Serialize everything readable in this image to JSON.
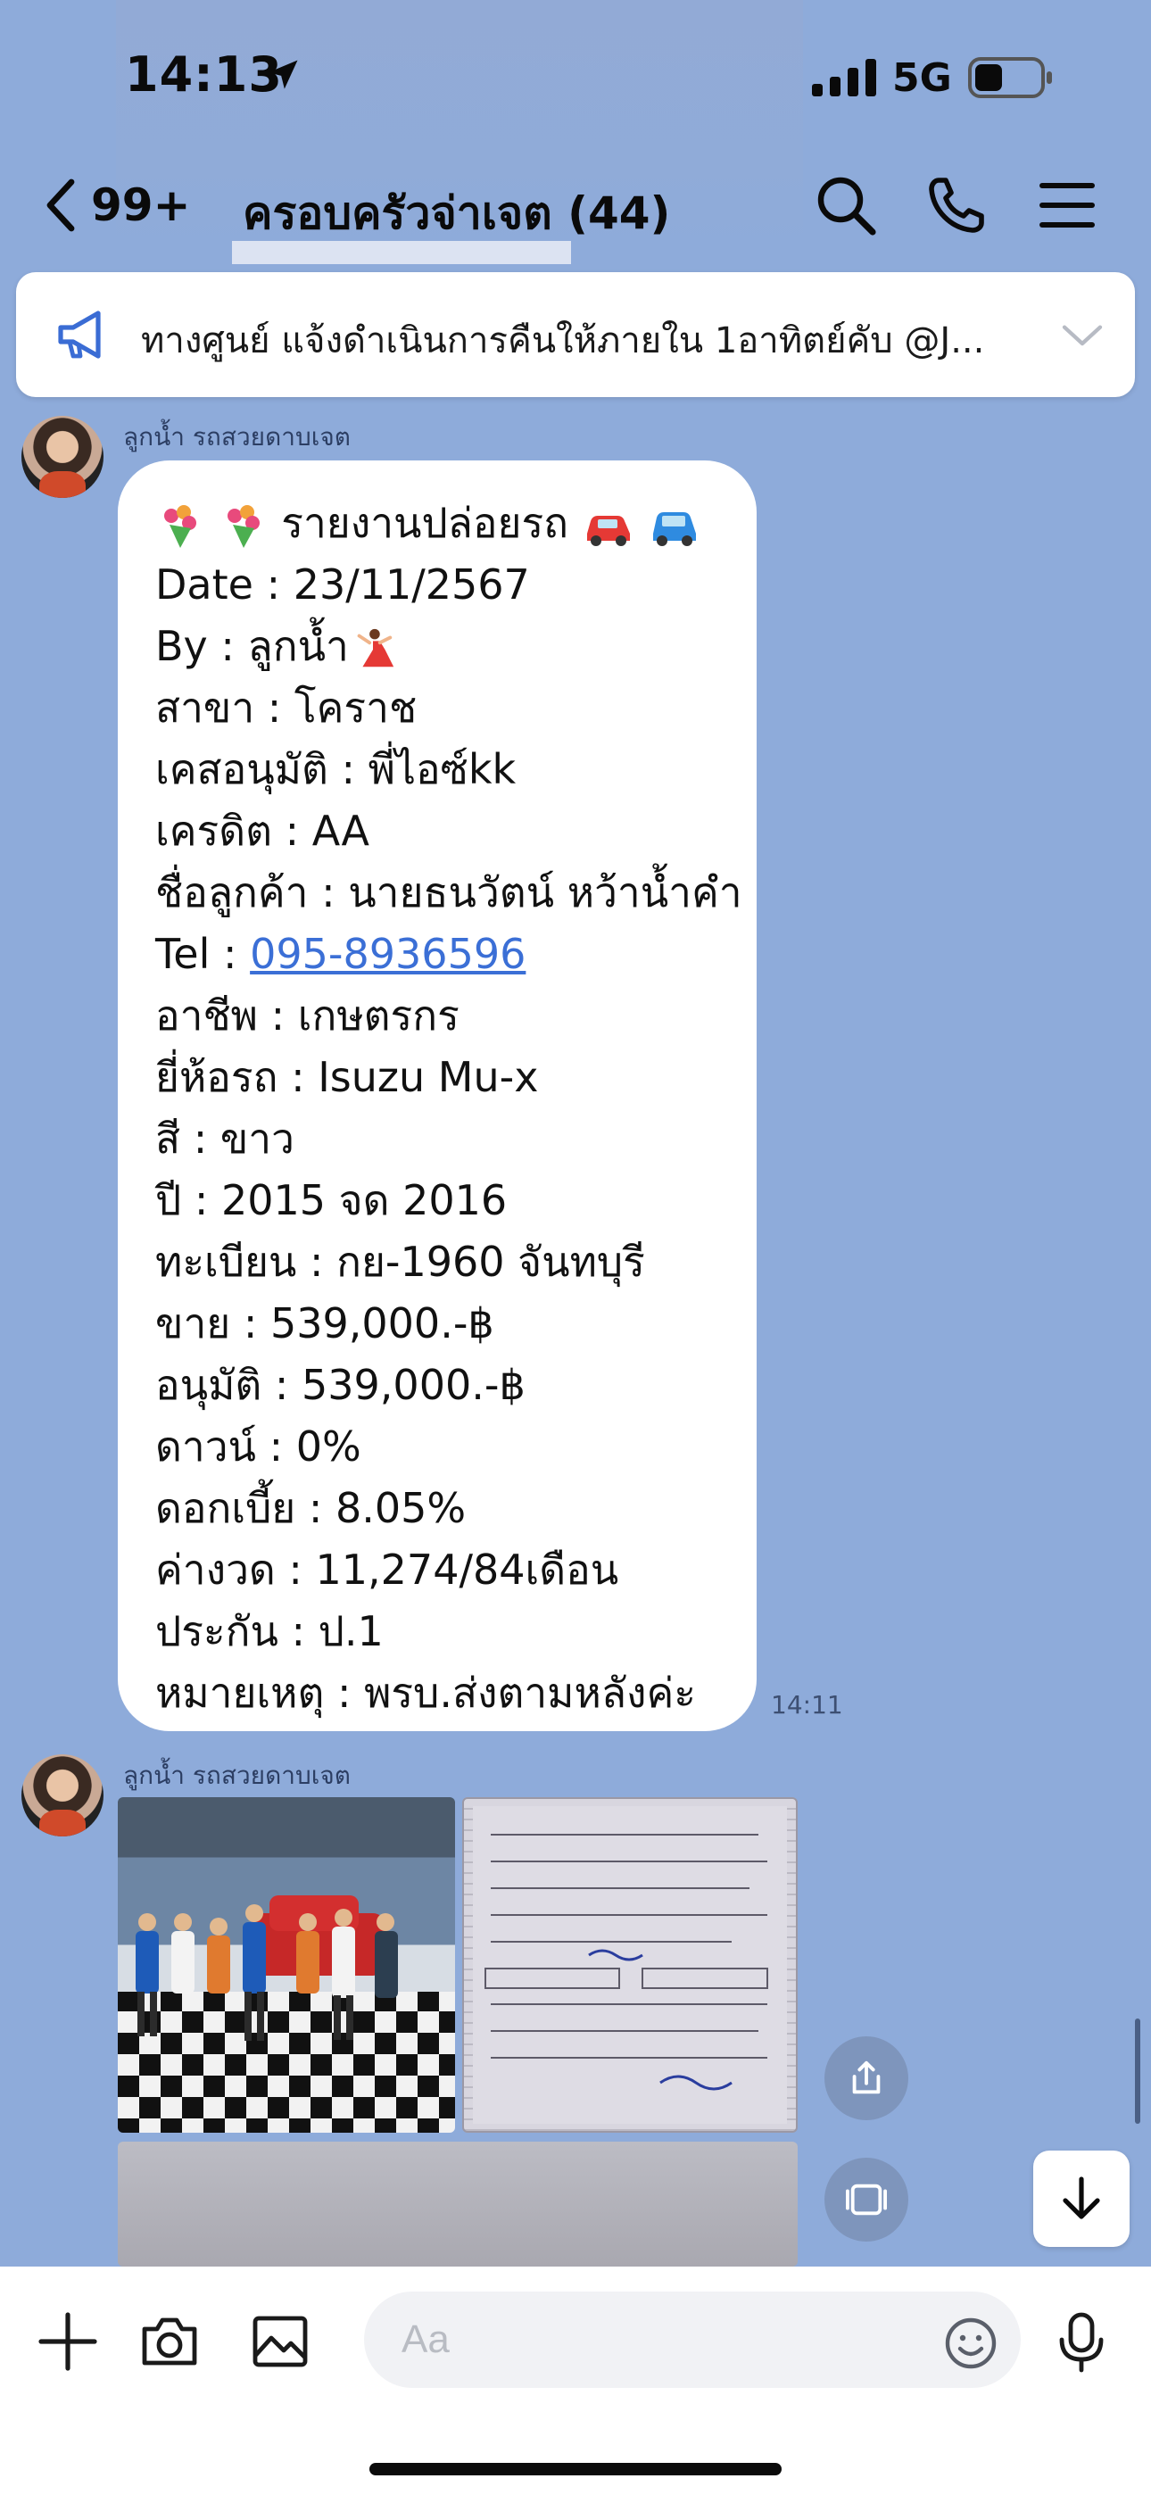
{
  "status": {
    "time": "14:13",
    "network": "5G"
  },
  "nav": {
    "back_count": "99+",
    "title": "ครอบครัวจ่าเจต (44)",
    "icons": [
      "search-icon",
      "phone-icon",
      "menu-icon"
    ]
  },
  "announcement": {
    "text": "ทางศูนย์ แจ้งดำเนินการคืนให้ภายใน 1อาทิตย์คับ @J..."
  },
  "messages": [
    {
      "sender": "ลูกน้ำ รถสวยดาบเจต",
      "time": "14:11",
      "lines": {
        "title": "รายงานปล่อยรถ",
        "date": "Date : 23/11/2567",
        "by": "By : ลูกน้ำ",
        "branch": "สาขา : โคราช",
        "approver": "เคสอนุมัติ : พี่ไอซ์kk",
        "credit": "เครดิต : AA",
        "customer": "ชื่อลูกค้า : นายธนวัตน์ หว้าน้ำคำ",
        "tel_label": "Tel : ",
        "tel_number": "095-8936596",
        "occupation": "อาชีพ : เกษตรกร",
        "brand": "ยี่ห้อรถ : Isuzu Mu-x",
        "color": "สี : ขาว",
        "year": "ปี : 2015 จด 2016",
        "plate": "ทะเบียน : กย-1960 จันทบุรี",
        "price": "ขาย : 539,000.-฿",
        "approved": "อนุมัติ : 539,000.-฿",
        "down": "ดาวน์ : 0%",
        "interest": "ดอกเบี้ย : 8.05%",
        "installment": "ค่างวด : 11,274/84เดือน",
        "insurance": "ประกัน : ป.1",
        "note": "หมายเหตุ : พรบ.ส่งตามหลังค่ะ"
      }
    },
    {
      "sender": "ลูกน้ำ รถสวยดาบเจต"
    }
  ],
  "input": {
    "placeholder": "Aa"
  },
  "colors": {
    "background": "#8eabda",
    "link": "#3b6fd6",
    "bubble": "#ffffff"
  }
}
